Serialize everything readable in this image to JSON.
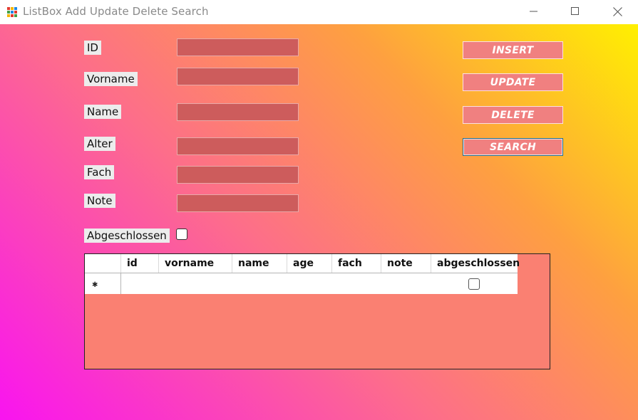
{
  "window": {
    "title": "ListBox Add Update Delete Search",
    "icons": [
      "app-icon",
      "minimize-icon",
      "maximize-icon",
      "close-icon"
    ]
  },
  "form": {
    "labels": {
      "id": "ID",
      "vorname": "Vorname",
      "name": "Name",
      "alter": "Alter",
      "fach": "Fach",
      "note": "Note",
      "abgeschlossen": "Abgeschlossen"
    },
    "values": {
      "id": "",
      "vorname": "",
      "name": "",
      "alter": "",
      "fach": "",
      "note": ""
    },
    "abgeschlossen_checked": false
  },
  "buttons": {
    "insert": "INSERT",
    "update": "UPDATE",
    "delete": "DELETE",
    "search": "SEARCH"
  },
  "grid": {
    "columns": [
      "id",
      "vorname",
      "name",
      "age",
      "fach",
      "note",
      "abgeschlossen"
    ],
    "new_row_indicator": "✱",
    "rows": [
      {
        "id": "",
        "vorname": "",
        "name": "",
        "age": "",
        "fach": "",
        "note": "",
        "abgeschlossen": false
      }
    ]
  },
  "colors": {
    "gradient": [
      "#fff000",
      "#fea040",
      "#fd6e8a",
      "#f914f0"
    ],
    "textbox": "#cd5c5c",
    "button": "#f08080",
    "grid_background": "#fa8072"
  }
}
